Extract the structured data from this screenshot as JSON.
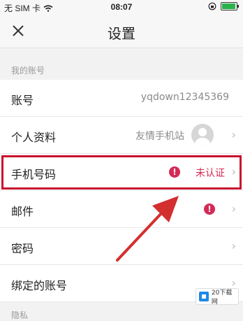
{
  "status": {
    "carrier": "无 SIM 卡",
    "time": "08:07"
  },
  "nav": {
    "title": "设置"
  },
  "sections": {
    "account": "我的账号",
    "next": "隐私"
  },
  "rows": [
    {
      "label": "账号",
      "value": "yqdown12345369"
    },
    {
      "label": "个人资料",
      "value": "友情手机站"
    },
    {
      "label": "手机号码",
      "value": "未认证",
      "alert": "!"
    },
    {
      "label": "邮件",
      "alert": "!"
    },
    {
      "label": "密码"
    },
    {
      "label": "绑定的账号"
    }
  ],
  "chevron": "›",
  "watermark": {
    "text": "20下载网"
  },
  "colors": {
    "highlight": "#c8102e",
    "alert": "#d42a56",
    "arrow": "#d32f2f"
  }
}
